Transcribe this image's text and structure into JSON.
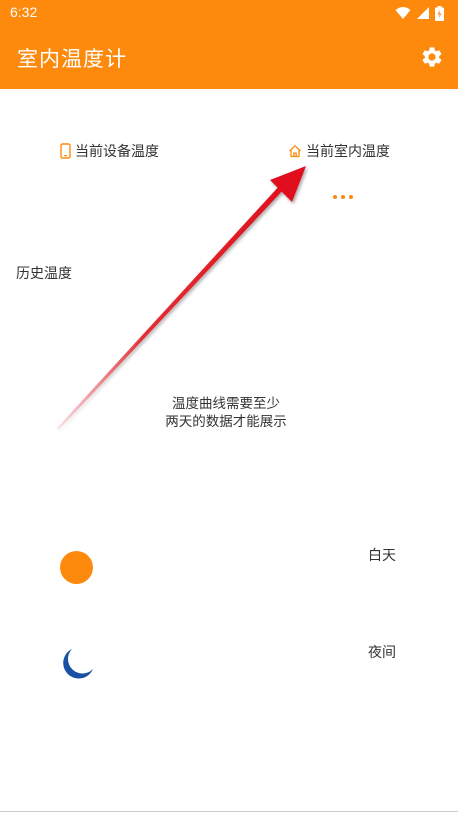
{
  "status_bar": {
    "time": "6:32",
    "icons": [
      "wifi-icon",
      "signal-icon",
      "battery-icon"
    ]
  },
  "app_bar": {
    "title": "室内温度计",
    "settings_icon": "gear-icon"
  },
  "temperature": {
    "device_label": "当前设备温度",
    "device_icon": "phone-icon",
    "indoor_label": "当前室内温度",
    "indoor_icon": "home-icon"
  },
  "history": {
    "label": "历史温度",
    "message_line1": "温度曲线需要至少",
    "message_line2": "两天的数据才能展示"
  },
  "legend": {
    "day_label": "白天",
    "night_label": "夜间",
    "day_icon": "sun-icon",
    "night_icon": "moon-icon"
  },
  "colors": {
    "primary": "#fd8a0c",
    "night": "#1a4fa3",
    "arrow": "#e0101a",
    "text": "#333333"
  }
}
